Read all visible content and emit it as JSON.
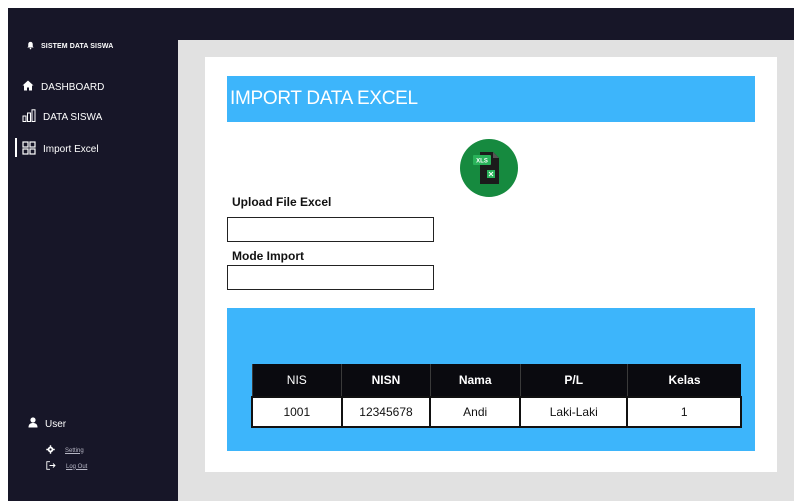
{
  "app": {
    "title": "SISTEM DATA SISWA"
  },
  "sidebar": {
    "items": [
      {
        "label": "DASHBOARD",
        "icon": "home-icon"
      },
      {
        "label": "DATA SISWA",
        "icon": "bar-chart-icon"
      },
      {
        "label": "Import Excel",
        "icon": "grid-icon",
        "active": true
      }
    ],
    "user": {
      "label": "User",
      "icon": "user-icon"
    },
    "links": [
      {
        "label": "Setting",
        "icon": "gear-icon"
      },
      {
        "label": "Log Out",
        "icon": "logout-icon"
      }
    ]
  },
  "main": {
    "title": "IMPORT DATA EXCEL",
    "upload": {
      "label": "Upload File Excel",
      "value": ""
    },
    "mode": {
      "label": "Mode Import",
      "value": ""
    },
    "file_icon_text": "XLS",
    "table": {
      "columns": [
        "NIS",
        "NISN",
        "Nama",
        "P/L",
        "Kelas"
      ],
      "rows": [
        [
          "1001",
          "12345678",
          "Andi",
          "Laki-Laki",
          "1"
        ]
      ]
    }
  },
  "colors": {
    "sidebar": "#171628",
    "accent": "#3db5fb",
    "content_bg": "#e1e1e1",
    "excel_green": "#168a3f"
  }
}
